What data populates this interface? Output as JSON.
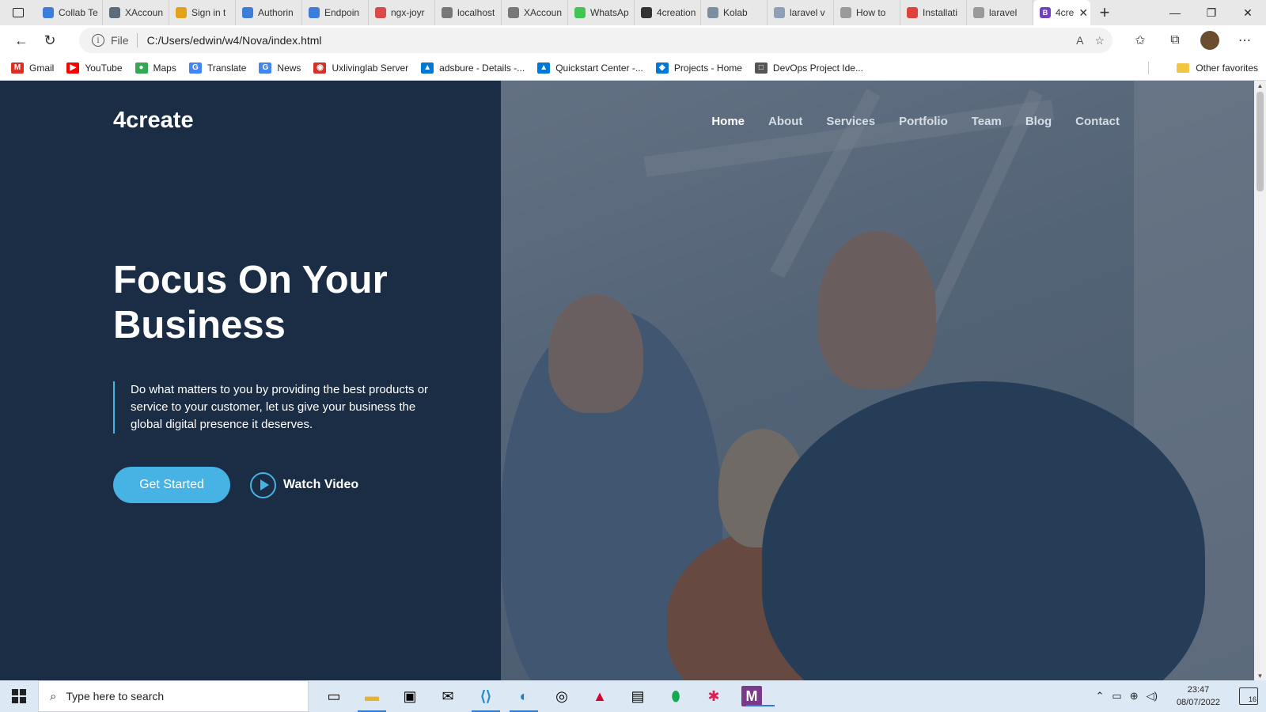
{
  "browser": {
    "tabs": [
      {
        "title": "Collab Te",
        "color": "#3b7dd8"
      },
      {
        "title": "XAccoun",
        "color": "#5a6b7b"
      },
      {
        "title": "Sign in t",
        "color": "#e3a21a"
      },
      {
        "title": "Authorin",
        "color": "#3b7dd8"
      },
      {
        "title": "Endpoin",
        "color": "#3b7dd8"
      },
      {
        "title": "ngx-joyr",
        "color": "#d94a4a"
      },
      {
        "title": "localhost",
        "color": "#777777"
      },
      {
        "title": "XAccoun",
        "color": "#777777"
      },
      {
        "title": "WhatsAp",
        "color": "#43c554"
      },
      {
        "title": "4creation",
        "color": "#333333"
      },
      {
        "title": "Kolab",
        "color": "#7c8ea0"
      },
      {
        "title": "laravel v",
        "color": "#8ea0b6"
      },
      {
        "title": "How to",
        "color": "#9a9a9a"
      },
      {
        "title": "Installati",
        "color": "#e0433b"
      },
      {
        "title": "laravel",
        "color": "#9a9a9a"
      }
    ],
    "active_tab": {
      "title": "4cre",
      "favicon": "B",
      "color": "#6f42c1"
    },
    "address": {
      "protocol": "File",
      "url": "C:/Users/edwin/w4/Nova/index.html"
    },
    "favorites": [
      {
        "label": "Gmail",
        "icon": "M",
        "color": "#d93025"
      },
      {
        "label": "YouTube",
        "icon": "▶",
        "color": "#ff0000"
      },
      {
        "label": "Maps",
        "icon": "●",
        "color": "#34a853"
      },
      {
        "label": "Translate",
        "icon": "G",
        "color": "#4285f4"
      },
      {
        "label": "News",
        "icon": "G",
        "color": "#4285f4"
      },
      {
        "label": "Uxlivinglab Server",
        "icon": "◉",
        "color": "#d93025"
      },
      {
        "label": "adsbure - Details -...",
        "icon": "▲",
        "color": "#0078d4"
      },
      {
        "label": "Quickstart Center -...",
        "icon": "▲",
        "color": "#0078d4"
      },
      {
        "label": "Projects - Home",
        "icon": "◆",
        "color": "#0078d4"
      },
      {
        "label": "DevOps Project Ide...",
        "icon": "□",
        "color": "#555555"
      }
    ],
    "other_favorites": "Other favorites"
  },
  "site": {
    "brand": "4create",
    "nav": [
      "Home",
      "About",
      "Services",
      "Portfolio",
      "Team",
      "Blog",
      "Contact"
    ],
    "active_nav": "Home",
    "hero_title": "Focus On Your Business",
    "hero_description": "Do what matters to you by providing the best products or service to your customer, let us give your business the global digital presence it deserves.",
    "cta_primary": "Get Started",
    "cta_secondary": "Watch Video",
    "colors": {
      "panel": "#1b2d45",
      "accent": "#47b2e4"
    }
  },
  "taskbar": {
    "search_placeholder": "Type here to search",
    "time": "23:47",
    "date": "08/07/2022",
    "notifications": "16"
  }
}
